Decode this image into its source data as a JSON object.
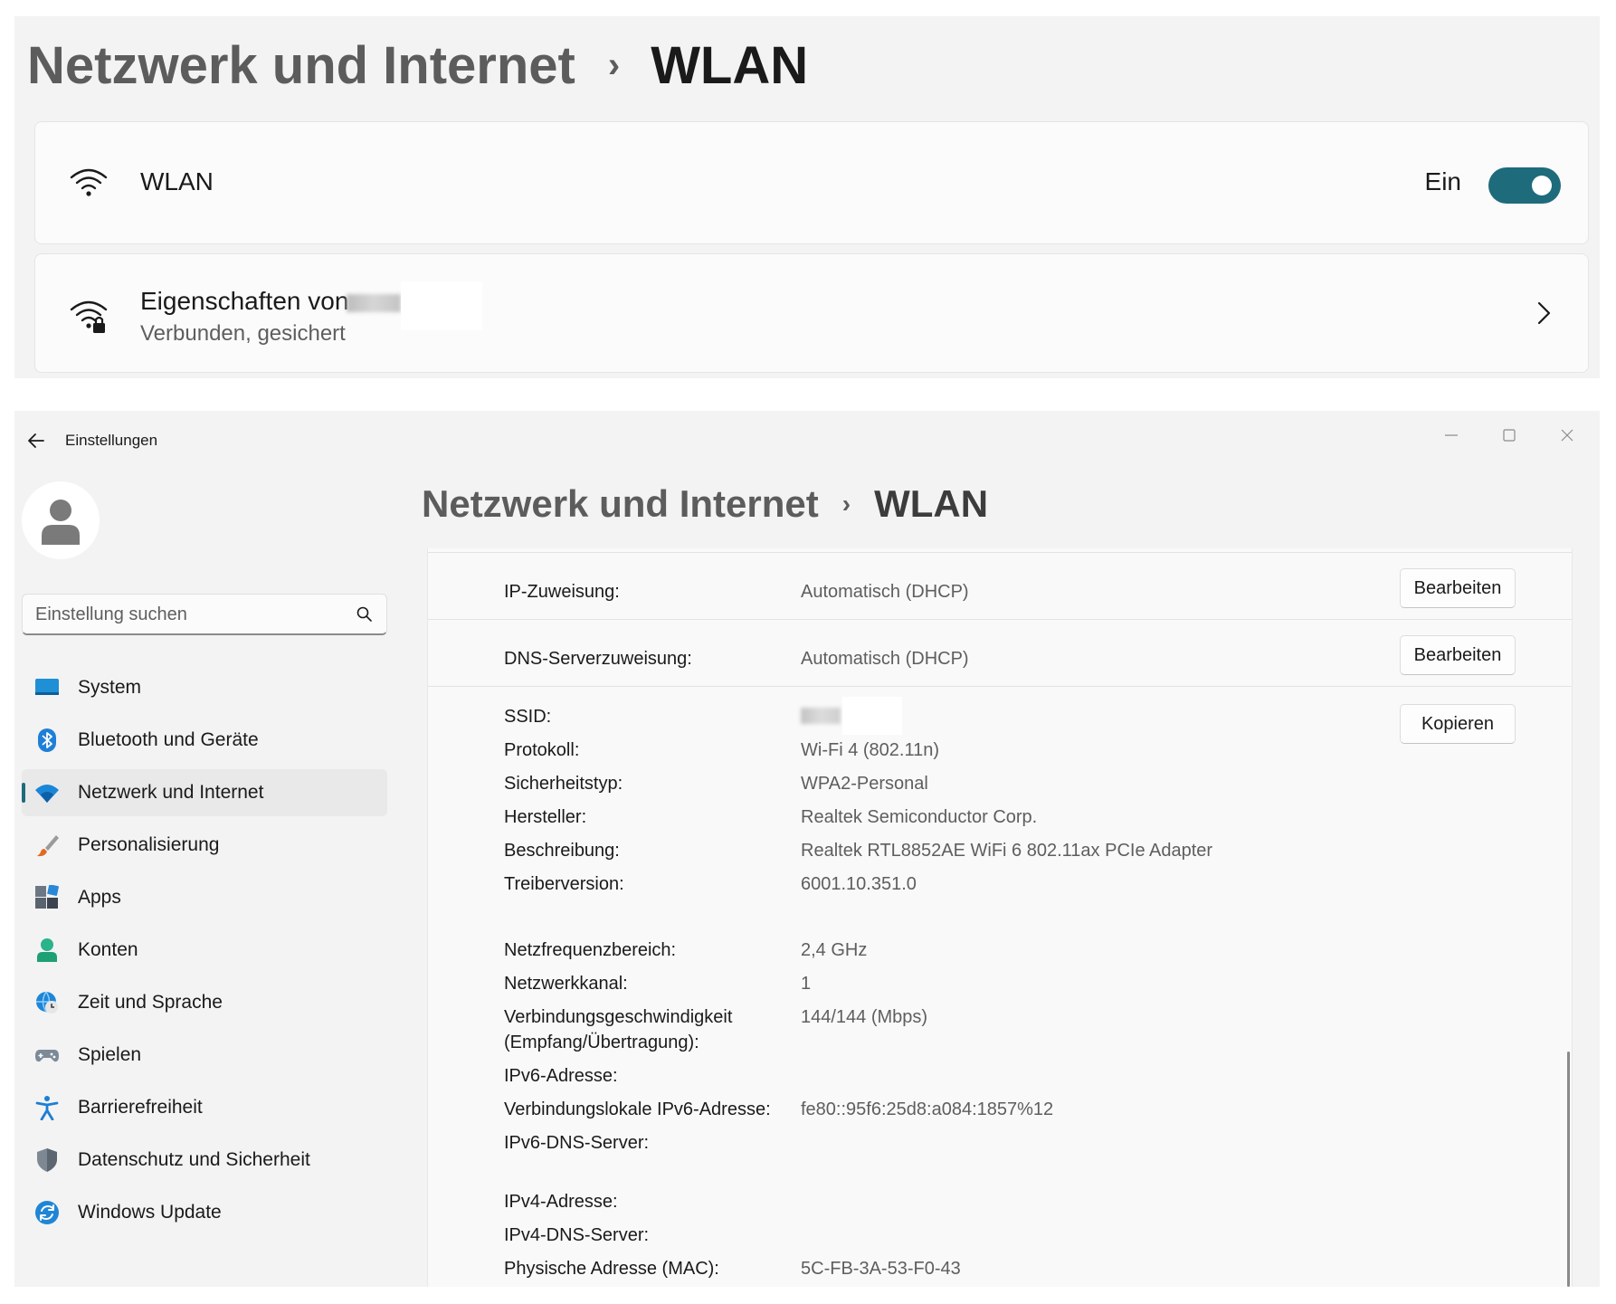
{
  "top_panel": {
    "breadcrumb": {
      "parent": "Netzwerk und Internet",
      "separator": "›",
      "current": "WLAN"
    },
    "wlan_card": {
      "title": "WLAN",
      "toggle_label": "Ein",
      "toggle_on": true,
      "icon": "wifi-icon"
    },
    "props_card": {
      "title": "Eigenschaften von",
      "subtitle": "Verbunden, gesichert",
      "icon": "wifi-lock-icon"
    }
  },
  "window": {
    "title": "Einstellungen",
    "controls": {
      "minimize": "minimize-icon",
      "maximize": "maximize-icon",
      "close": "close-icon"
    },
    "search": {
      "placeholder": "Einstellung suchen"
    },
    "nav": [
      {
        "label": "System",
        "icon": "system-icon"
      },
      {
        "label": "Bluetooth und Geräte",
        "icon": "bluetooth-icon"
      },
      {
        "label": "Netzwerk und Internet",
        "icon": "network-icon",
        "active": true
      },
      {
        "label": "Personalisierung",
        "icon": "brush-icon"
      },
      {
        "label": "Apps",
        "icon": "apps-icon"
      },
      {
        "label": "Konten",
        "icon": "account-icon"
      },
      {
        "label": "Zeit und Sprache",
        "icon": "time-language-icon"
      },
      {
        "label": "Spielen",
        "icon": "gamepad-icon"
      },
      {
        "label": "Barrierefreiheit",
        "icon": "accessibility-icon"
      },
      {
        "label": "Datenschutz und Sicherheit",
        "icon": "shield-icon"
      },
      {
        "label": "Windows Update",
        "icon": "update-icon"
      }
    ],
    "breadcrumb": {
      "parent": "Netzwerk und Internet",
      "separator": "›",
      "current": "WLAN"
    },
    "properties": {
      "ip_assignment": {
        "label": "IP-Zuweisung:",
        "value": "Automatisch (DHCP)",
        "button": "Bearbeiten"
      },
      "dns_assignment": {
        "label": "DNS-Serverzuweisung:",
        "value": "Automatisch (DHCP)",
        "button": "Bearbeiten"
      },
      "copy_button": "Kopieren",
      "details": [
        {
          "label": "SSID:",
          "value": ""
        },
        {
          "label": "Protokoll:",
          "value": "Wi-Fi 4 (802.11n)"
        },
        {
          "label": "Sicherheitstyp:",
          "value": "WPA2-Personal"
        },
        {
          "label": "Hersteller:",
          "value": "Realtek Semiconductor Corp."
        },
        {
          "label": "Beschreibung:",
          "value": "Realtek RTL8852AE WiFi 6 802.11ax PCIe Adapter"
        },
        {
          "label": "Treiberversion:",
          "value": "6001.10.351.0"
        },
        {
          "label": "Netzfrequenzbereich:",
          "value": "2,4 GHz"
        },
        {
          "label": "Netzwerkkanal:",
          "value": "1"
        },
        {
          "label": "Verbindungsgeschwindigkeit",
          "value": "144/144 (Mbps)"
        },
        {
          "label": "(Empfang/Übertragung):",
          "value": ""
        },
        {
          "label": "IPv6-Adresse:",
          "value": ""
        },
        {
          "label": "Verbindungslokale IPv6-Adresse:",
          "value": "fe80::95f6:25d8:a084:1857%12"
        },
        {
          "label": "IPv6-DNS-Server:",
          "value": ""
        },
        {
          "label": "IPv4-Adresse:",
          "value": ""
        },
        {
          "label": "IPv4-DNS-Server:",
          "value": ""
        },
        {
          "label": "Physische Adresse (MAC):",
          "value": "5C-FB-3A-53-F0-43"
        }
      ]
    }
  },
  "colors": {
    "accent": "#1e6b7b",
    "panel_bg": "#f3f3f3",
    "card_bg": "#fbfbfb",
    "secondary_text": "#5e5e5e"
  }
}
